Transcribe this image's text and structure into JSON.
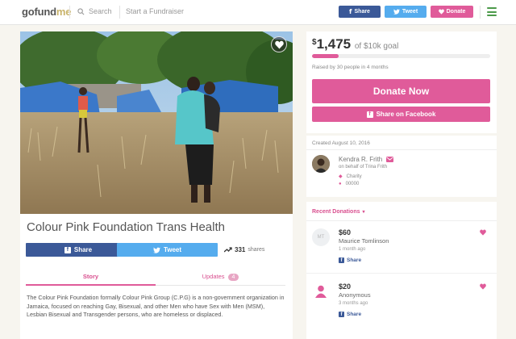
{
  "header": {
    "logo_part1": "gofund",
    "logo_part2": "me",
    "search_label": "Search",
    "start_fundraiser": "Start a Fundraiser",
    "share_label": "Share",
    "tweet_label": "Tweet",
    "donate_label": "Donate"
  },
  "campaign": {
    "title": "Colour Pink Foundation Trans Health",
    "share_label": "Share",
    "tweet_label": "Tweet",
    "shares_count": "331",
    "shares_word": "shares",
    "tabs": {
      "story": "Story",
      "updates": "Updates",
      "updates_count": "4"
    },
    "story_text": "The Colour Pink Foundation formally Colour Pink Group (C.P.G) is a non-government organization in Jamaica, focused on reaching Gay, Bisexual, and other Men who have Sex with Men (MSM), Lesbian Bisexual and Transgender persons, who are homeless or displaced."
  },
  "goal": {
    "currency": "$",
    "raised": "1,475",
    "goal_text": "of $10k goal",
    "progress_fraction": 0.1475,
    "raised_by": "Raised by 30 people in 4 months",
    "donate_now": "Donate Now",
    "share_facebook": "Share on Facebook"
  },
  "organizer": {
    "created": "Created August 10, 2016",
    "name": "Kendra R. Frith",
    "behalf": "on behalf of Trina Frith",
    "category": "Charity",
    "location": "00000"
  },
  "donations": {
    "header": "Recent Donations",
    "items": [
      {
        "initials": "MT",
        "amount": "$60",
        "name": "Maurice Tomlinson",
        "time": "1 month ago",
        "share": "Share"
      },
      {
        "initials": "",
        "amount": "$20",
        "name": "Anonymous",
        "time": "3 months ago",
        "share": "Share"
      }
    ]
  },
  "colors": {
    "brand_pink": "#e05b9a",
    "facebook_blue": "#3b5998",
    "twitter_blue": "#55acee",
    "menu_green": "#4c9a4a"
  }
}
